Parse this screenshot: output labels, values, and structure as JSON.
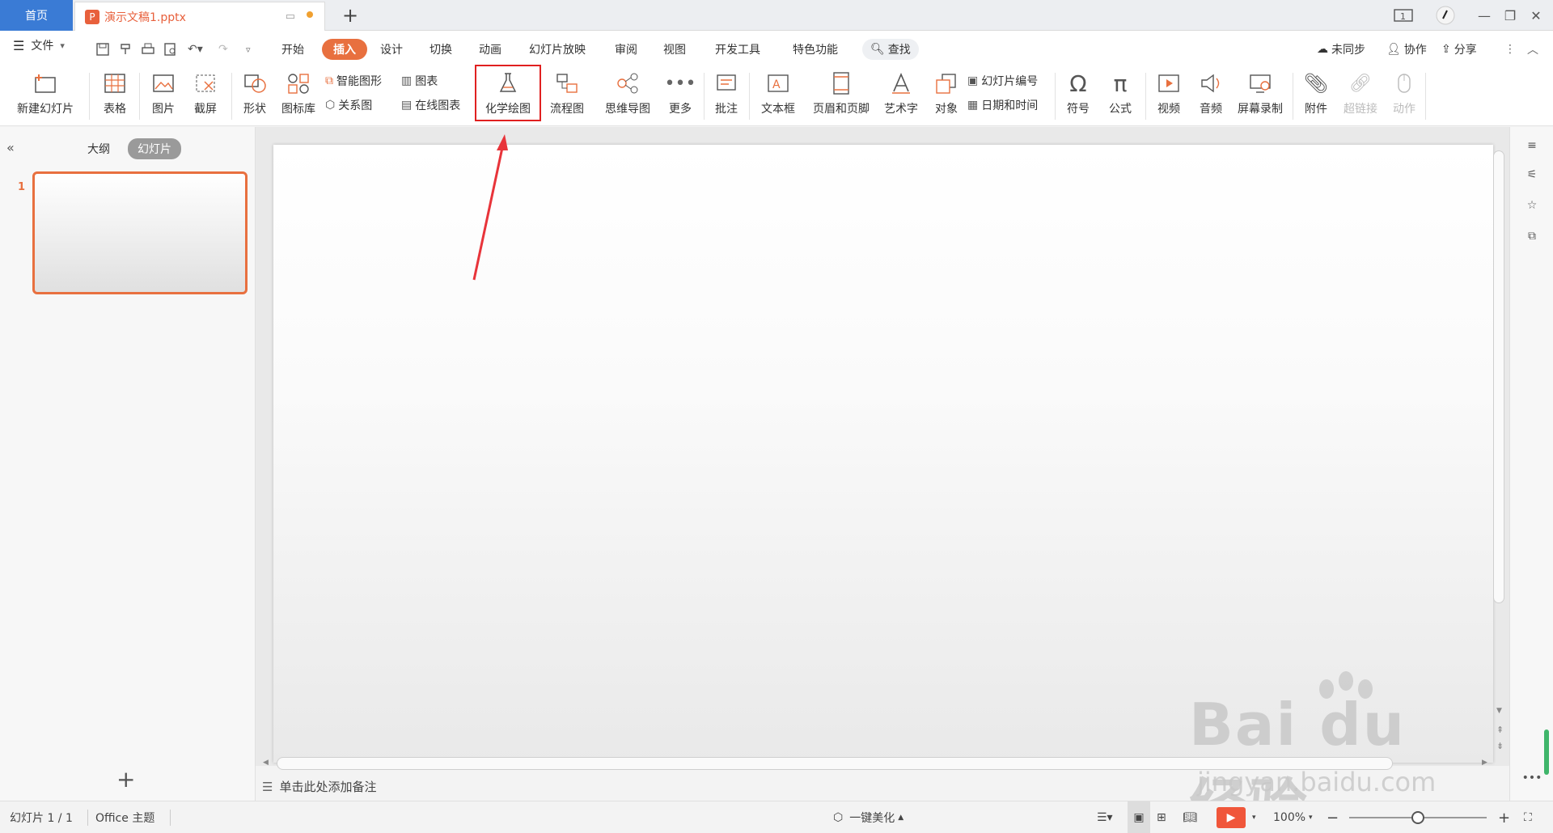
{
  "titlebar": {
    "home_tab": "首页",
    "doc_tab": "演示文稿1.pptx",
    "doc_icon": "P"
  },
  "menubar": {
    "file": "文件",
    "tabs": [
      "开始",
      "插入",
      "设计",
      "切换",
      "动画",
      "幻灯片放映",
      "审阅",
      "视图",
      "开发工具",
      "特色功能"
    ],
    "active_tab": "插入",
    "search": "查找",
    "sync": "未同步",
    "collab": "协作",
    "share": "分享"
  },
  "ribbon": {
    "new_slide": "新建幻灯片",
    "table": "表格",
    "picture": "图片",
    "screenshot": "截屏",
    "shape": "形状",
    "icon_lib": "图标库",
    "smart_art": "智能图形",
    "chart": "图表",
    "relation": "关系图",
    "online_chart": "在线图表",
    "chem": "化学绘图",
    "flow": "流程图",
    "mind": "思维导图",
    "more": "更多",
    "comment": "批注",
    "textbox": "文本框",
    "header_footer": "页眉和页脚",
    "wordart": "艺术字",
    "object": "对象",
    "slide_number": "幻灯片编号",
    "datetime": "日期和时间",
    "symbol": "符号",
    "formula": "公式",
    "video": "视频",
    "audio": "音频",
    "screen_record": "屏幕录制",
    "attachment": "附件",
    "hyperlink": "超链接",
    "action": "动作"
  },
  "leftpanel": {
    "outline_tab": "大纲",
    "slides_tab": "幻灯片",
    "slide_number": "1"
  },
  "notes": {
    "placeholder": "单击此处添加备注"
  },
  "statusbar": {
    "slide_info": "幻灯片 1 / 1",
    "theme": "Office 主题",
    "beautify": "一键美化",
    "zoom": "100%",
    "zoom_level": 0.5
  },
  "watermark": {
    "title": "Bai du 经验",
    "url": "jingyan.baidu.com"
  },
  "colors": {
    "accent": "#e8703f",
    "home_tab": "#3a7bd5",
    "highlight": "#e02020",
    "play": "#f0563a"
  }
}
